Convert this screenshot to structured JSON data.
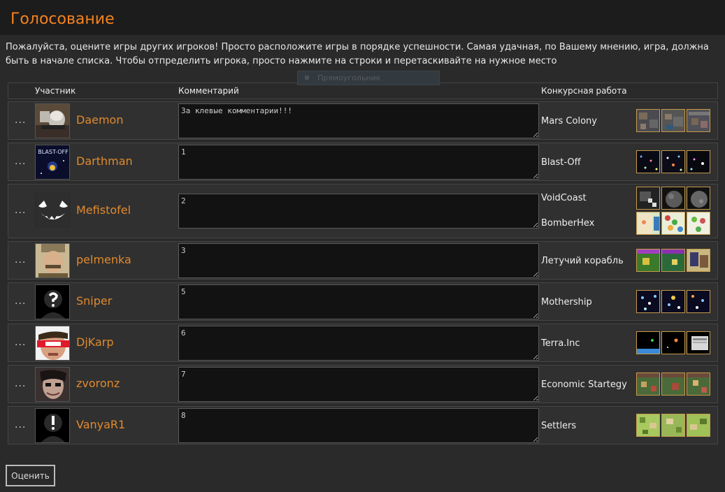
{
  "page": {
    "title": "Голосование",
    "intro": "Пожалуйста, оцените игры других игроков! Просто расположите игры в порядке успешности. Самая удачная, по Вашему мнению, игра, должна быть в начале списка. Чтобы отпределить игрока, просто нажмите на строки и перетаскивайте на нужное место",
    "ghost_label": "Прямоугольник"
  },
  "table": {
    "headers": {
      "participant": "Участник",
      "comment": "Комментарий",
      "entry": "Конкурсная работа"
    },
    "handle_glyph": "...",
    "rows": [
      {
        "name": "Daemon",
        "comment": "За клевые комментарии!!!",
        "games": [
          "Mars Colony"
        ]
      },
      {
        "name": "Darthman",
        "comment": "1",
        "games": [
          "Blast-Off"
        ]
      },
      {
        "name": "Mefistofel",
        "comment": "2",
        "games": [
          "VoidCoast",
          "BomberHex"
        ]
      },
      {
        "name": "pelmenka",
        "comment": "3",
        "games": [
          "Летучий корабль"
        ]
      },
      {
        "name": "Sniper",
        "comment": "5",
        "games": [
          "Mothership"
        ]
      },
      {
        "name": "DjKarp",
        "comment": "6",
        "games": [
          "Terra.Inc"
        ]
      },
      {
        "name": "zvoronz",
        "comment": "7",
        "games": [
          "Economic Startegy"
        ]
      },
      {
        "name": "VanyaR1",
        "comment": "8",
        "games": [
          "Settlers"
        ]
      }
    ]
  },
  "avatar_texts": {
    "darthman": "BLAST-OFF"
  },
  "submit_label": "Оценить",
  "colors": {
    "accent": "#f5821f",
    "name": "#e08a2e",
    "background": "#2a2a2a"
  }
}
